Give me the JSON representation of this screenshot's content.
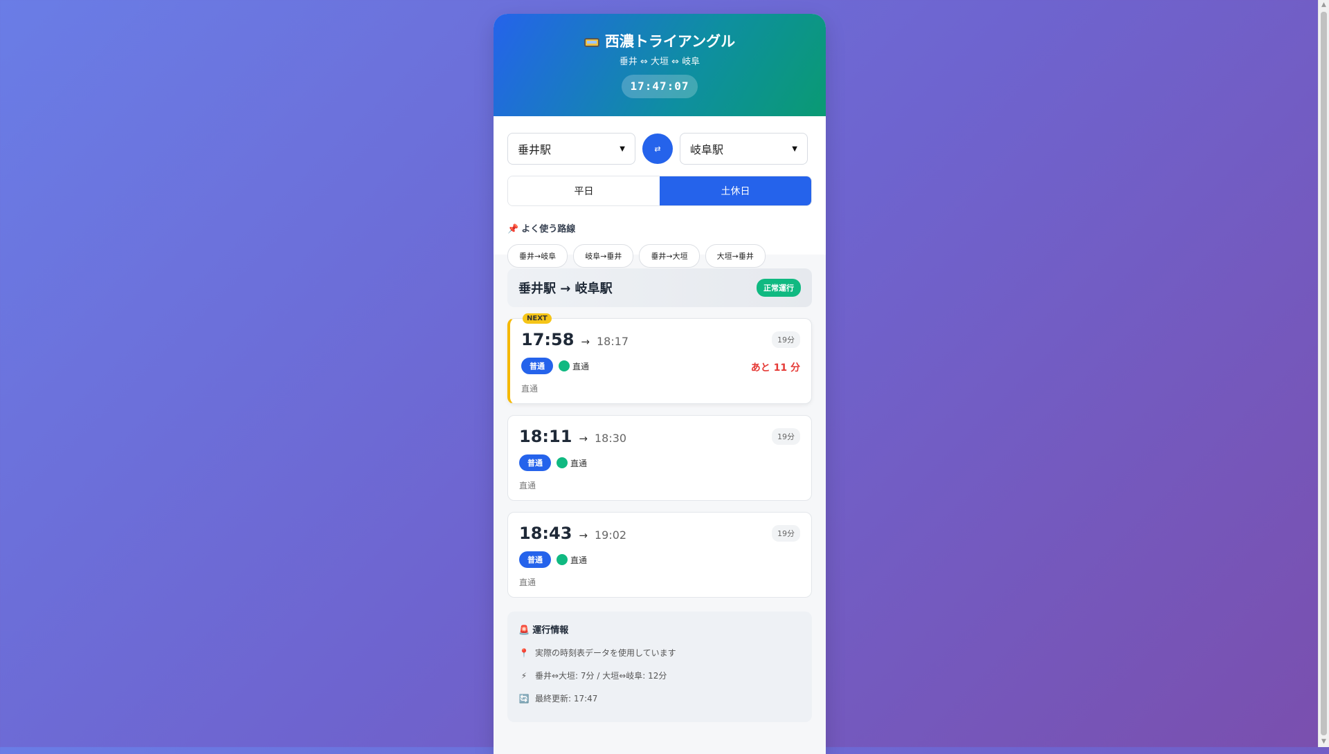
{
  "header": {
    "title": "西濃トライアングル",
    "subtitle": "垂井 ⇔ 大垣 ⇔ 岐阜",
    "clock": "17:47:07"
  },
  "controls": {
    "from_station": "垂井駅",
    "to_station": "岐阜駅",
    "swap_label": "⇄",
    "day_tabs": [
      {
        "label": "平日",
        "active": false
      },
      {
        "label": "土休日",
        "active": true
      }
    ],
    "favorites_title": "よく使う路線",
    "favorites": [
      "垂井→岐阜",
      "岐阜→垂井",
      "垂井→大垣",
      "大垣→垂井"
    ]
  },
  "results": {
    "route_title": "垂井駅 → 岐阜駅",
    "status": "正常運行",
    "next_label": "NEXT",
    "trains": [
      {
        "dep": "17:58",
        "arr": "18:17",
        "duration": "19分",
        "type": "普通",
        "direct": "直通",
        "note": "直通",
        "countdown": "あと 11 分"
      },
      {
        "dep": "18:11",
        "arr": "18:30",
        "duration": "19分",
        "type": "普通",
        "direct": "直通",
        "note": "直通"
      },
      {
        "dep": "18:43",
        "arr": "19:02",
        "duration": "19分",
        "type": "普通",
        "direct": "直通",
        "note": "直通"
      }
    ]
  },
  "info": {
    "title": "運行情報",
    "lines": [
      {
        "icon": "pin-icon",
        "text": "実際の時刻表データを使用しています"
      },
      {
        "icon": "lightning-icon",
        "text": "垂井⇔大垣: 7分 / 大垣⇔岐阜: 12分"
      },
      {
        "icon": "refresh-icon",
        "text": "最終更新: 17:47"
      }
    ]
  },
  "colors": {
    "accent": "#2563eb",
    "success": "#10b981",
    "warning": "#f5b800",
    "danger": "#e53935"
  }
}
